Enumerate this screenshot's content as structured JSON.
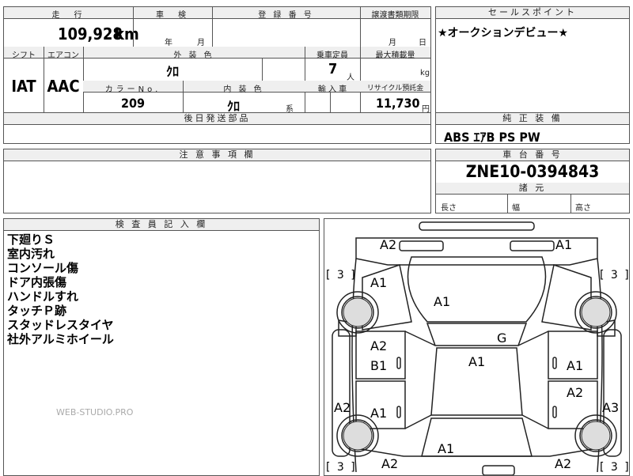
{
  "sheet": {
    "odometer_label": "走　行",
    "odometer_value": "109,928",
    "odometer_unit": "km",
    "inspection_label": "車　検",
    "inspection_year": "年",
    "inspection_month": "月",
    "registration_label": "登 録 番 号",
    "transfer_docs_label": "譲渡書類期限",
    "transfer_month": "月",
    "transfer_day": "日",
    "sales_point_label": "セールスポイント",
    "sales_point_text": "★オークションデビュー★",
    "shift_label": "シフト",
    "shift_value": "IAT",
    "ac_label": "エアコン",
    "ac_value": "AAC",
    "exterior_color_label": "外 装 色",
    "exterior_color_value": "ｸﾛ",
    "capacity_label": "乗車定員",
    "capacity_value": "7",
    "capacity_unit": "人",
    "max_load_label": "最大積載量",
    "max_load_unit": "kg",
    "color_no_label": "カラーNo.",
    "color_no_value": "209",
    "interior_color_label": "内 装 色",
    "interior_color_value": "ｸﾛ",
    "interior_color_suffix": "系",
    "import_label": "輸 入 車",
    "recycle_label": "リサイクル預託金",
    "recycle_value": "11,730",
    "recycle_unit": "円",
    "delivery_parts_label": "後日発送部品",
    "genuine_equipment_label": "純 正 装 備",
    "genuine_equipment_value": "ABS ｴｱB PS PW",
    "notes_label": "注 意 事 項 欄",
    "chassis_label": "車 台 番 号",
    "chassis_value": "ZNE10-0394843",
    "dimensions_label": "諸 元",
    "length_label": "長さ",
    "width_label": "幅",
    "height_label": "高さ",
    "inspector_label": "検 査 員 記 入 欄",
    "inspector_notes": [
      "下廻りＳ",
      "室内汚れ",
      "コンソール傷",
      "ドア内張傷",
      "ハンドルすれ",
      "タッチＰ跡",
      "スタッドレスタイヤ",
      "社外アルミホイール"
    ],
    "watermark": "WEB-STUDIO.PRO"
  },
  "damage_map": {
    "front_left": "A2",
    "front_right": "A1",
    "tire_fl": "[ 3 ]",
    "tire_fr": "[ 3 ]",
    "tire_rl": "[ 3 ]",
    "tire_rr": "[ 3 ]",
    "fender_fl": "A1",
    "hood": "A1",
    "door_fl_1": "A2",
    "door_fl_2": "B1",
    "windshield": "G",
    "roof": "A1",
    "door_fr": "A1",
    "door_rr": "A2",
    "side_left": "A2",
    "door_rl": "A1",
    "side_right": "A3",
    "rear_glass": "A1",
    "rear_left": "A2",
    "rear_right": "A2"
  }
}
